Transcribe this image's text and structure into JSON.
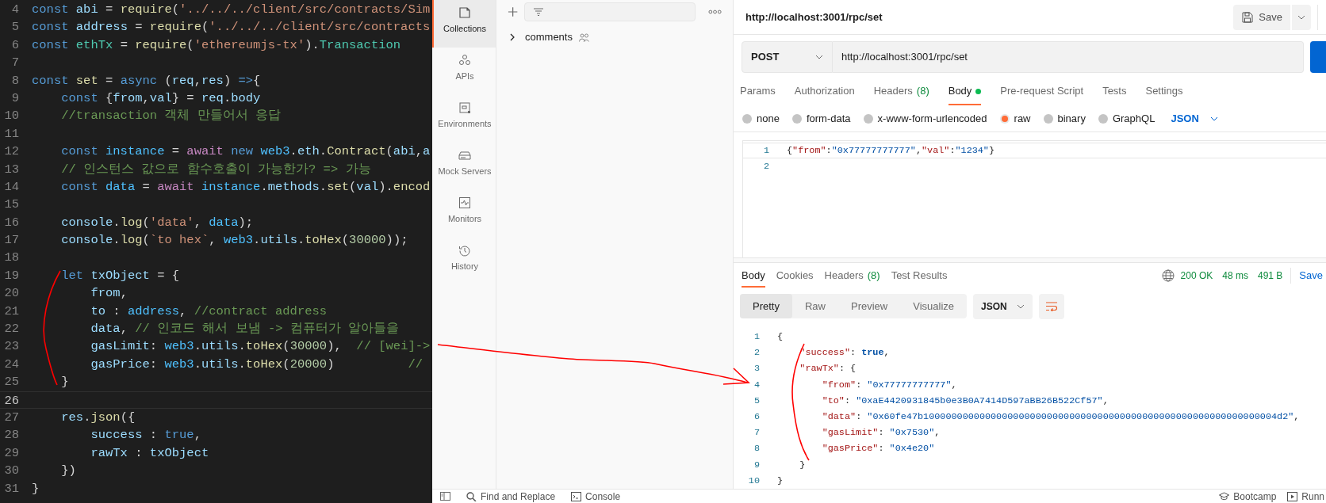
{
  "editor": {
    "lines": [
      {
        "number": "4",
        "tokens": [
          {
            "kind": "keyword",
            "text": "const"
          },
          {
            "kind": "variable",
            "text": " abi"
          },
          {
            "kind": "plain",
            "text": " = "
          },
          {
            "kind": "function",
            "text": "require"
          },
          {
            "kind": "plain",
            "text": "("
          },
          {
            "kind": "string",
            "text": "'../../../client/src/contracts/Sim"
          }
        ]
      },
      {
        "number": "5",
        "tokens": [
          {
            "kind": "keyword",
            "text": "const"
          },
          {
            "kind": "variable",
            "text": " address"
          },
          {
            "kind": "plain",
            "text": " = "
          },
          {
            "kind": "function",
            "text": "require"
          },
          {
            "kind": "plain",
            "text": "("
          },
          {
            "kind": "string",
            "text": "'../../../client/src/contracts"
          }
        ]
      },
      {
        "number": "6",
        "tokens": [
          {
            "kind": "keyword",
            "text": "const"
          },
          {
            "kind": "type",
            "text": " ethTx"
          },
          {
            "kind": "plain",
            "text": " = "
          },
          {
            "kind": "function",
            "text": "require"
          },
          {
            "kind": "plain",
            "text": "("
          },
          {
            "kind": "string",
            "text": "'ethereumjs-tx'"
          },
          {
            "kind": "plain",
            "text": ")."
          },
          {
            "kind": "type",
            "text": "Transaction"
          }
        ]
      },
      {
        "number": "7"
      },
      {
        "number": "8",
        "tokens": [
          {
            "kind": "keyword",
            "text": "const"
          },
          {
            "kind": "function",
            "text": " set"
          },
          {
            "kind": "plain",
            "text": " = "
          },
          {
            "kind": "keyword",
            "text": "async"
          },
          {
            "kind": "plain",
            "text": " ("
          },
          {
            "kind": "variable",
            "text": "req"
          },
          {
            "kind": "plain",
            "text": ","
          },
          {
            "kind": "variable",
            "text": "res"
          },
          {
            "kind": "plain",
            "text": ") "
          },
          {
            "kind": "keyword",
            "text": "=>"
          },
          {
            "kind": "plain",
            "text": "{"
          }
        ]
      },
      {
        "number": "9",
        "tokens": [
          {
            "kind": "keyword",
            "text": "    const"
          },
          {
            "kind": "plain",
            "text": " {"
          },
          {
            "kind": "variable",
            "text": "from"
          },
          {
            "kind": "plain",
            "text": ","
          },
          {
            "kind": "variable",
            "text": "val"
          },
          {
            "kind": "plain",
            "text": "} = "
          },
          {
            "kind": "variable",
            "text": "req"
          },
          {
            "kind": "plain",
            "text": "."
          },
          {
            "kind": "variable",
            "text": "body"
          }
        ]
      },
      {
        "number": "10",
        "tokens": [
          {
            "kind": "comment",
            "text": "    //transaction 객체 만들어서 응답"
          }
        ]
      },
      {
        "number": "11"
      },
      {
        "number": "12",
        "tokens": [
          {
            "kind": "keyword",
            "text": "    const"
          },
          {
            "kind": "constant",
            "text": " instance"
          },
          {
            "kind": "plain",
            "text": " = "
          },
          {
            "kind": "control",
            "text": "await"
          },
          {
            "kind": "keyword",
            "text": " new"
          },
          {
            "kind": "constant",
            "text": " web3"
          },
          {
            "kind": "plain",
            "text": "."
          },
          {
            "kind": "variable",
            "text": "eth"
          },
          {
            "kind": "plain",
            "text": "."
          },
          {
            "kind": "function",
            "text": "Contract"
          },
          {
            "kind": "plain",
            "text": "("
          },
          {
            "kind": "variable",
            "text": "abi"
          },
          {
            "kind": "plain",
            "text": ","
          },
          {
            "kind": "variable",
            "text": "a"
          }
        ]
      },
      {
        "number": "13",
        "tokens": [
          {
            "kind": "comment",
            "text": "    // 인스턴스 값으로 함수호출이 가능한가? => 가능"
          }
        ]
      },
      {
        "number": "14",
        "tokens": [
          {
            "kind": "keyword",
            "text": "    const"
          },
          {
            "kind": "constant",
            "text": " data"
          },
          {
            "kind": "plain",
            "text": " = "
          },
          {
            "kind": "control",
            "text": "await"
          },
          {
            "kind": "constant",
            "text": " instance"
          },
          {
            "kind": "plain",
            "text": "."
          },
          {
            "kind": "variable",
            "text": "methods"
          },
          {
            "kind": "plain",
            "text": "."
          },
          {
            "kind": "function",
            "text": "set"
          },
          {
            "kind": "plain",
            "text": "("
          },
          {
            "kind": "variable",
            "text": "val"
          },
          {
            "kind": "plain",
            "text": ")."
          },
          {
            "kind": "function",
            "text": "encod"
          }
        ]
      },
      {
        "number": "15"
      },
      {
        "number": "16",
        "tokens": [
          {
            "kind": "variable",
            "text": "    console"
          },
          {
            "kind": "plain",
            "text": "."
          },
          {
            "kind": "function",
            "text": "log"
          },
          {
            "kind": "plain",
            "text": "("
          },
          {
            "kind": "string",
            "text": "'data'"
          },
          {
            "kind": "plain",
            "text": ","
          },
          {
            "kind": "constant",
            "text": " data"
          },
          {
            "kind": "plain",
            "text": ");"
          }
        ]
      },
      {
        "number": "17",
        "tokens": [
          {
            "kind": "variable",
            "text": "    console"
          },
          {
            "kind": "plain",
            "text": "."
          },
          {
            "kind": "function",
            "text": "log"
          },
          {
            "kind": "plain",
            "text": "("
          },
          {
            "kind": "string",
            "text": "`to hex`"
          },
          {
            "kind": "plain",
            "text": ","
          },
          {
            "kind": "constant",
            "text": " web3"
          },
          {
            "kind": "plain",
            "text": "."
          },
          {
            "kind": "variable",
            "text": "utils"
          },
          {
            "kind": "plain",
            "text": "."
          },
          {
            "kind": "function",
            "text": "toHex"
          },
          {
            "kind": "plain",
            "text": "("
          },
          {
            "kind": "number",
            "text": "30000"
          },
          {
            "kind": "plain",
            "text": "));"
          }
        ]
      },
      {
        "number": "18"
      },
      {
        "number": "19",
        "tokens": [
          {
            "kind": "keyword",
            "text": "    let"
          },
          {
            "kind": "variable",
            "text": " txObject"
          },
          {
            "kind": "plain",
            "text": " = {"
          }
        ]
      },
      {
        "number": "20",
        "tokens": [
          {
            "kind": "variable",
            "text": "        from"
          },
          {
            "kind": "plain",
            "text": ","
          }
        ]
      },
      {
        "number": "21",
        "tokens": [
          {
            "kind": "variable",
            "text": "        to"
          },
          {
            "kind": "plain",
            "text": " : "
          },
          {
            "kind": "constant",
            "text": "address"
          },
          {
            "kind": "plain",
            "text": ","
          },
          {
            "kind": "comment",
            "text": " //contract address"
          }
        ]
      },
      {
        "number": "22",
        "tokens": [
          {
            "kind": "variable",
            "text": "        data"
          },
          {
            "kind": "plain",
            "text": ","
          },
          {
            "kind": "comment",
            "text": " // 인코드 해서 보냄 -> 컴퓨터가 알아들을"
          }
        ]
      },
      {
        "number": "23",
        "tokens": [
          {
            "kind": "variable",
            "text": "        gasLimit"
          },
          {
            "kind": "plain",
            "text": ": "
          },
          {
            "kind": "constant",
            "text": "web3"
          },
          {
            "kind": "plain",
            "text": "."
          },
          {
            "kind": "variable",
            "text": "utils"
          },
          {
            "kind": "plain",
            "text": "."
          },
          {
            "kind": "function",
            "text": "toHex"
          },
          {
            "kind": "plain",
            "text": "("
          },
          {
            "kind": "number",
            "text": "30000"
          },
          {
            "kind": "plain",
            "text": "),"
          },
          {
            "kind": "comment",
            "text": "  // [wei]->"
          }
        ]
      },
      {
        "number": "24",
        "tokens": [
          {
            "kind": "variable",
            "text": "        gasPrice"
          },
          {
            "kind": "plain",
            "text": ": "
          },
          {
            "kind": "constant",
            "text": "web3"
          },
          {
            "kind": "plain",
            "text": "."
          },
          {
            "kind": "variable",
            "text": "utils"
          },
          {
            "kind": "plain",
            "text": "."
          },
          {
            "kind": "function",
            "text": "toHex"
          },
          {
            "kind": "plain",
            "text": "("
          },
          {
            "kind": "number",
            "text": "20000"
          },
          {
            "kind": "plain",
            "text": ")"
          },
          {
            "kind": "comment",
            "text": "          //"
          }
        ]
      },
      {
        "number": "25",
        "tokens": [
          {
            "kind": "plain",
            "text": "    }"
          }
        ]
      },
      {
        "number": "26",
        "current": true
      },
      {
        "number": "27",
        "tokens": [
          {
            "kind": "variable",
            "text": "    res"
          },
          {
            "kind": "plain",
            "text": "."
          },
          {
            "kind": "function",
            "text": "json"
          },
          {
            "kind": "plain",
            "text": "({"
          }
        ]
      },
      {
        "number": "28",
        "tokens": [
          {
            "kind": "variable",
            "text": "        success"
          },
          {
            "kind": "plain",
            "text": " : "
          },
          {
            "kind": "keyword",
            "text": "true"
          },
          {
            "kind": "plain",
            "text": ","
          }
        ]
      },
      {
        "number": "29",
        "tokens": [
          {
            "kind": "variable",
            "text": "        rawTx"
          },
          {
            "kind": "plain",
            "text": " : "
          },
          {
            "kind": "variable",
            "text": "txObject"
          }
        ]
      },
      {
        "number": "30",
        "tokens": [
          {
            "kind": "plain",
            "text": "    })"
          }
        ]
      },
      {
        "number": "31",
        "tokens": [
          {
            "kind": "plain",
            "text": "}"
          }
        ]
      }
    ]
  },
  "nav": {
    "items": [
      {
        "kind": "collections",
        "label": "Collections",
        "selected": true
      },
      {
        "kind": "apis",
        "label": "APIs",
        "selected": false
      },
      {
        "kind": "environments",
        "label": "Environments",
        "selected": false
      },
      {
        "kind": "mock",
        "label": "Mock Servers",
        "selected": false
      },
      {
        "kind": "monitors",
        "label": "Monitors",
        "selected": false
      },
      {
        "kind": "history",
        "label": "History",
        "selected": false
      }
    ]
  },
  "collections": {
    "items": [
      {
        "label": "comments"
      }
    ]
  },
  "request": {
    "title": "http://localhost:3001/rpc/set",
    "save_label": "Save",
    "method": "POST",
    "url": "http://localhost:3001/rpc/set",
    "tabs": [
      {
        "label": "Params",
        "selected": false
      },
      {
        "label": "Authorization",
        "selected": false
      },
      {
        "label": "Headers",
        "count": "(8)",
        "selected": false
      },
      {
        "label": "Body",
        "has_content": true,
        "selected": true
      },
      {
        "label": "Pre-request Script",
        "selected": false
      },
      {
        "label": "Tests",
        "selected": false
      },
      {
        "label": "Settings",
        "selected": false
      }
    ],
    "body_modes": [
      {
        "label": "none",
        "selected": false
      },
      {
        "label": "form-data",
        "selected": false
      },
      {
        "label": "x-www-form-urlencoded",
        "selected": false
      },
      {
        "label": "raw",
        "selected": true
      },
      {
        "label": "binary",
        "selected": false
      },
      {
        "label": "GraphQL",
        "selected": false
      }
    ],
    "body_format": "JSON",
    "body_lines": [
      {
        "number": "1",
        "current": true,
        "tokens": [
          {
            "kind": "bracket",
            "text": "{"
          },
          {
            "kind": "key",
            "text": "\"from\""
          },
          {
            "kind": "punct",
            "text": ":"
          },
          {
            "kind": "string",
            "text": "\"0x77777777777\""
          },
          {
            "kind": "punct",
            "text": ","
          },
          {
            "kind": "key",
            "text": "\"val\""
          },
          {
            "kind": "punct",
            "text": ":"
          },
          {
            "kind": "string",
            "text": "\"1234\""
          },
          {
            "kind": "bracket",
            "text": "}"
          }
        ]
      },
      {
        "number": "2"
      }
    ]
  },
  "response": {
    "tabs": [
      {
        "label": "Body",
        "selected": true
      },
      {
        "label": "Cookies",
        "selected": false
      },
      {
        "label": "Headers",
        "count": "(8)",
        "selected": false
      },
      {
        "label": "Test Results",
        "selected": false
      }
    ],
    "status": "200 OK",
    "time": "48 ms",
    "size": "491 B",
    "save_label": "Save",
    "views": [
      {
        "label": "Pretty",
        "selected": true
      },
      {
        "label": "Raw",
        "selected": false
      },
      {
        "label": "Preview",
        "selected": false
      },
      {
        "label": "Visualize",
        "selected": false
      }
    ],
    "format": "JSON",
    "lines": [
      {
        "number": "1",
        "tokens": [
          {
            "kind": "bracket",
            "text": "{"
          }
        ]
      },
      {
        "number": "2",
        "tokens": [
          {
            "kind": "key",
            "text": "    \"success\""
          },
          {
            "kind": "punct",
            "text": ": "
          },
          {
            "kind": "bool",
            "text": "true"
          },
          {
            "kind": "punct",
            "text": ","
          }
        ]
      },
      {
        "number": "3",
        "tokens": [
          {
            "kind": "key",
            "text": "    \"rawTx\""
          },
          {
            "kind": "punct",
            "text": ": {"
          }
        ]
      },
      {
        "number": "4",
        "tokens": [
          {
            "kind": "key",
            "text": "        \"from\""
          },
          {
            "kind": "punct",
            "text": ": "
          },
          {
            "kind": "string",
            "text": "\"0x77777777777\""
          },
          {
            "kind": "punct",
            "text": ","
          }
        ]
      },
      {
        "number": "5",
        "tokens": [
          {
            "kind": "key",
            "text": "        \"to\""
          },
          {
            "kind": "punct",
            "text": ": "
          },
          {
            "kind": "string",
            "text": "\"0xaE4420931845b0e3B0A7414D597aBB26B522Cf57\""
          },
          {
            "kind": "punct",
            "text": ","
          }
        ]
      },
      {
        "number": "6",
        "tokens": [
          {
            "kind": "key",
            "text": "        \"data\""
          },
          {
            "kind": "punct",
            "text": ": "
          },
          {
            "kind": "string",
            "text": "\"0x60fe47b100000000000000000000000000000000000000000000000000000000000004d2\""
          },
          {
            "kind": "punct",
            "text": ","
          }
        ]
      },
      {
        "number": "7",
        "tokens": [
          {
            "kind": "key",
            "text": "        \"gasLimit\""
          },
          {
            "kind": "punct",
            "text": ": "
          },
          {
            "kind": "string",
            "text": "\"0x7530\""
          },
          {
            "kind": "punct",
            "text": ","
          }
        ]
      },
      {
        "number": "8",
        "tokens": [
          {
            "kind": "key",
            "text": "        \"gasPrice\""
          },
          {
            "kind": "punct",
            "text": ": "
          },
          {
            "kind": "string",
            "text": "\"0x4e20\""
          }
        ]
      },
      {
        "number": "9",
        "tokens": [
          {
            "kind": "bracket",
            "text": "    }"
          }
        ]
      },
      {
        "number": "10",
        "tokens": [
          {
            "kind": "bracket",
            "text": "}"
          }
        ]
      }
    ]
  },
  "status_bar": {
    "left": [
      {
        "kind": "find",
        "label": "Find and Replace"
      },
      {
        "kind": "console",
        "label": "Console"
      }
    ],
    "right": [
      {
        "kind": "bootcamp",
        "label": "Bootcamp"
      },
      {
        "kind": "runner",
        "label": "Runn"
      }
    ]
  }
}
